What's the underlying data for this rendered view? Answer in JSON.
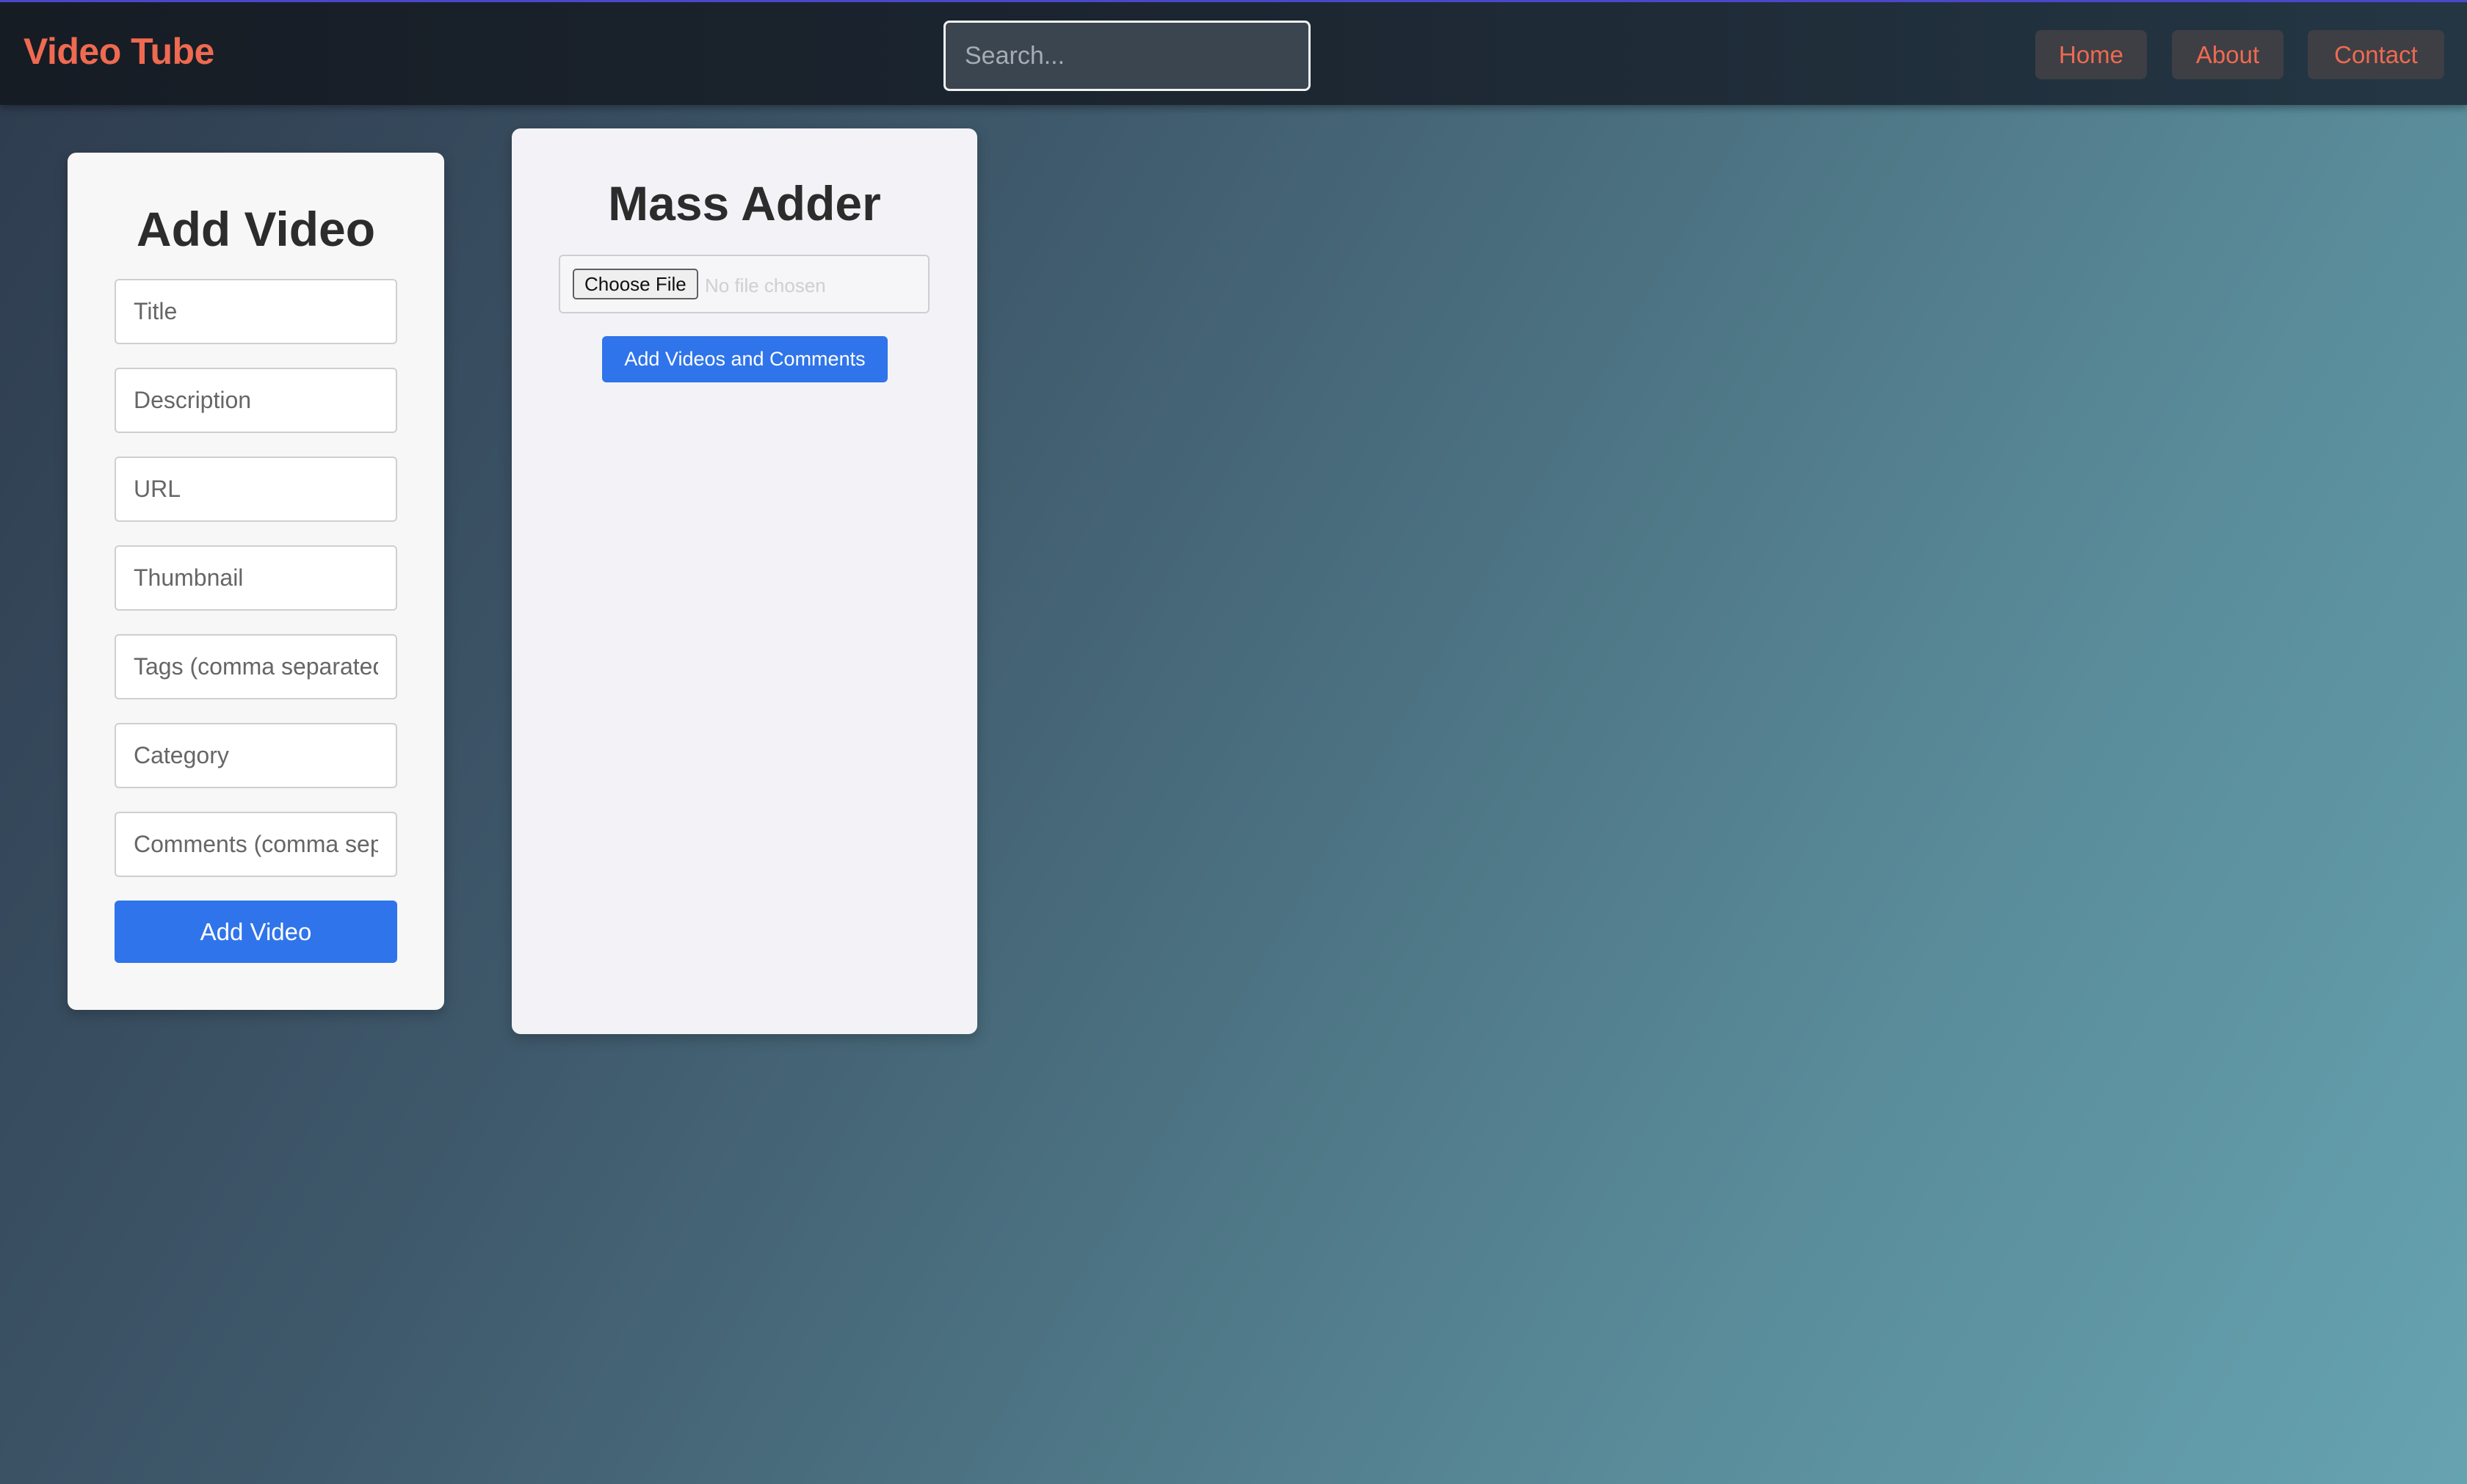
{
  "header": {
    "brand": "Video Tube",
    "search_placeholder": "Search...",
    "nav": {
      "home": "Home",
      "about": "About",
      "contact": "Contact"
    }
  },
  "add_video": {
    "title": "Add Video",
    "fields": {
      "title": "Title",
      "description": "Description",
      "url": "URL",
      "thumbnail": "Thumbnail",
      "tags": "Tags (comma separated)",
      "category": "Category",
      "comments": "Comments (comma separated)"
    },
    "submit_label": "Add Video"
  },
  "mass_adder": {
    "title": "Mass Adder",
    "choose_file_label": "Choose File",
    "file_status": "No file chosen",
    "submit_label": "Add Videos and Comments"
  },
  "colors": {
    "brand": "#ef6a50",
    "primary_button": "#2f74ea",
    "nav_button_bg": "#3d3f44"
  }
}
